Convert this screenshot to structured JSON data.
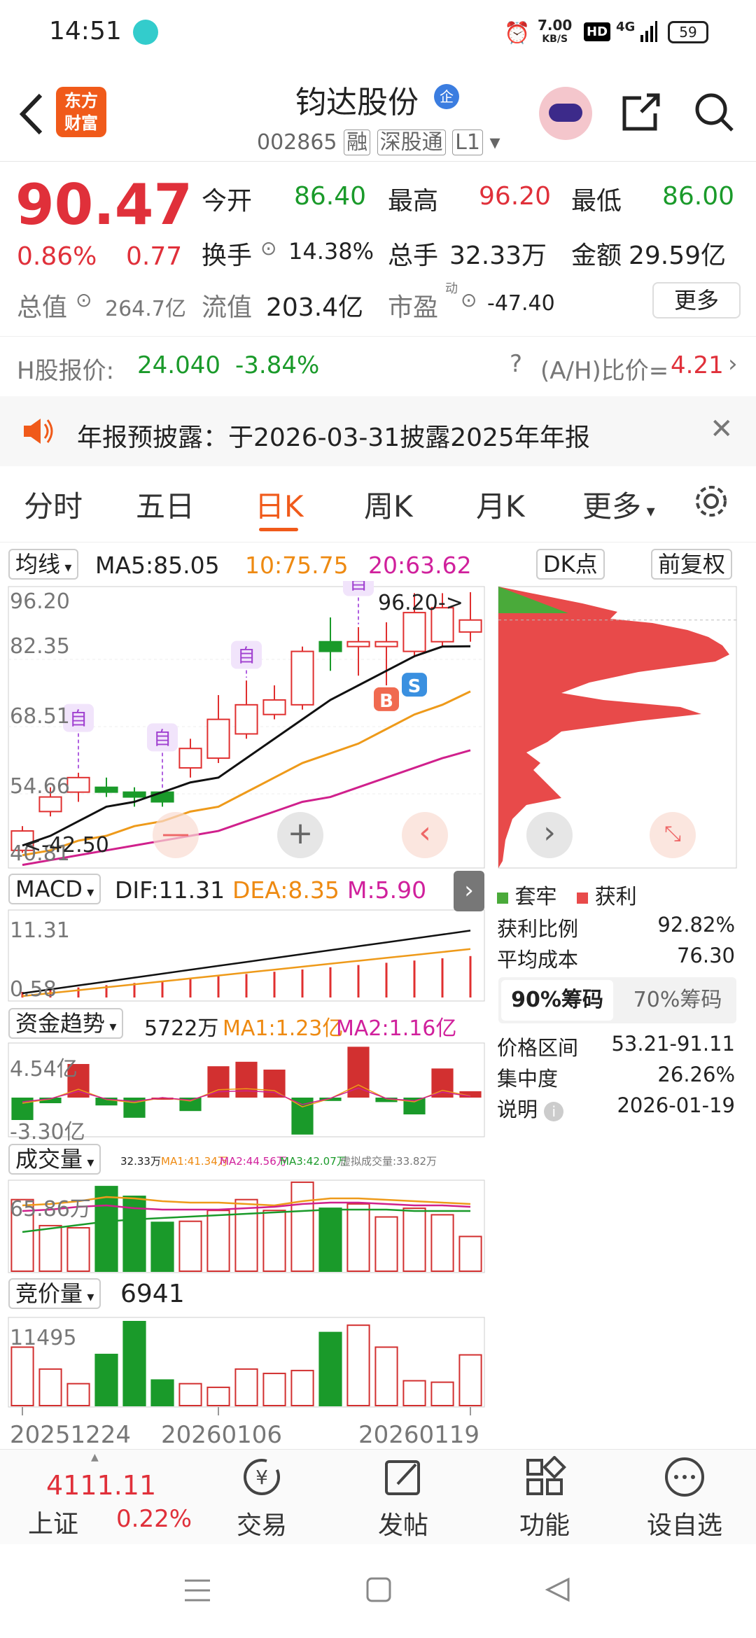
{
  "status": {
    "time": "14:51",
    "speed_top": "7.00",
    "speed_bottom": "KB/S",
    "hd": "HD",
    "net": "4G",
    "battery": "59"
  },
  "header": {
    "title": "钧达股份",
    "title_badge": "企",
    "code": "002865",
    "tag1": "融",
    "tag2": "深股通",
    "tag3": "L1",
    "logo_line1": "东方",
    "logo_line2": "财富"
  },
  "quote": {
    "price": "90.47",
    "pct": "0.86%",
    "chg": "0.77",
    "open_label": "今开",
    "open": "86.40",
    "high_label": "最高",
    "high": "96.20",
    "low_label": "最低",
    "low": "86.00",
    "turnover_label": "换手",
    "turnover": "14.38%",
    "vol_label": "总手",
    "vol": "32.33万",
    "amt_label": "金额",
    "amt": "29.59亿",
    "mcap_label": "总值",
    "mcap": "264.7亿",
    "float_label": "流值",
    "float": "203.4亿",
    "pe_label": "市盈",
    "pe_sup": "动",
    "pe": "-47.40",
    "more": "更多"
  },
  "hshare": {
    "label": "H股报价:",
    "price": "24.040",
    "pct": "-3.84%",
    "ah_label": "(A/H)比价=",
    "ah": "4.21"
  },
  "notice": {
    "text": "年报预披露：于2026-03-31披露2025年年报"
  },
  "tabs": [
    "分时",
    "五日",
    "日K",
    "周K",
    "月K",
    "更多"
  ],
  "ma": {
    "label": "均线",
    "ma5": "MA5:85.05",
    "ma10": "10:75.75",
    "ma20": "20:63.62",
    "dk": "DK点",
    "fq": "前复权"
  },
  "kline": {
    "ticks": [
      "96.20",
      "82.35",
      "68.51",
      "54.66",
      "40.81"
    ],
    "max_label": "96.20->",
    "min_label": "<-42.50",
    "self_label": "自",
    "buy_label": "B",
    "sell_label": "S"
  },
  "macd": {
    "label": "MACD",
    "dif": "DIF:11.31",
    "dea": "DEA:8.35",
    "m": "M:5.90",
    "top": "11.31",
    "bottom": "0.58"
  },
  "fund": {
    "label": "资金趋势",
    "val": "5722万",
    "ma1": "MA1:1.23亿",
    "ma2": "MA2:1.16亿",
    "top": "4.54亿",
    "bottom": "-3.30亿"
  },
  "volume": {
    "label": "成交量",
    "v": "32.33万",
    "ma1": "MA1:41.34万",
    "ma2": "MA2:44.56万",
    "ma3": "MA3:42.07万",
    "virtual": "虚拟成交量:33.82万",
    "top": "65.86万"
  },
  "auction": {
    "label": "竞价量",
    "val": "6941",
    "top": "11495"
  },
  "dates": [
    "20251224",
    "20260106",
    "20260119"
  ],
  "chips": {
    "legend1": "套牢",
    "legend2": "获利",
    "profit_label": "获利比例",
    "profit": "92.82%",
    "cost_label": "平均成本",
    "cost": "76.30",
    "tab90": "90%筹码",
    "tab70": "70%筹码",
    "range_label": "价格区间",
    "range": "53.21-91.11",
    "conc_label": "集中度",
    "conc": "26.26%",
    "desc_label": "说明",
    "desc": "2026-01-19"
  },
  "bottom": {
    "index_val": "4111.11",
    "index_name": "上证",
    "index_pct": "0.22%",
    "trade": "交易",
    "post": "发帖",
    "func": "功能",
    "fav": "设自选"
  },
  "chart_data": {
    "type": "candlestick",
    "dates": [
      "20251224",
      "",
      "",
      "",
      "",
      "",
      "",
      "20260106",
      "",
      "",
      "",
      "",
      "",
      "",
      "",
      "",
      "20260119"
    ],
    "open": [
      43,
      51,
      55,
      56,
      55,
      55,
      60,
      62,
      67,
      71,
      73,
      86,
      85,
      85,
      84,
      86,
      88
    ],
    "close": [
      47,
      54,
      58,
      55,
      54,
      53,
      64,
      70,
      73,
      74,
      84,
      84,
      86,
      86,
      92,
      93,
      90.47
    ],
    "high": [
      48,
      56,
      59,
      58,
      56,
      55,
      66,
      75,
      78,
      77,
      85,
      91,
      89,
      90,
      96,
      96,
      96.2
    ],
    "low": [
      42.5,
      50,
      53,
      54,
      52,
      52,
      58,
      61,
      66,
      70,
      72,
      80,
      79,
      77,
      83,
      85,
      86
    ],
    "ma5": [
      44,
      46,
      49,
      52,
      53,
      55,
      57,
      58,
      62,
      66,
      70,
      74,
      77,
      80,
      83,
      85,
      85.05
    ],
    "ma10": [
      42,
      43,
      45,
      46,
      48,
      49,
      51,
      52,
      55,
      58,
      61,
      63,
      65,
      68,
      71,
      73,
      75.75
    ],
    "ma20": [
      40,
      41,
      42,
      43,
      44,
      45,
      46,
      47,
      49,
      51,
      53,
      54,
      56,
      58,
      60,
      62,
      63.62
    ],
    "volume": [
      66,
      42,
      40,
      78,
      69,
      45,
      46,
      56,
      66,
      56,
      82,
      58,
      62,
      50,
      58,
      52,
      32
    ],
    "auction": [
      8000,
      5000,
      3000,
      7000,
      11495,
      3500,
      3000,
      2500,
      5000,
      4400,
      4800,
      10000,
      11000,
      8000,
      3400,
      3200,
      6941
    ],
    "fund": [
      -2.0,
      -0.5,
      3.0,
      -0.7,
      -1.8,
      0,
      -1.2,
      2.8,
      3.2,
      2.5,
      -3.3,
      -0.3,
      4.54,
      -0.4,
      -1.5,
      2.6,
      0.57
    ]
  }
}
